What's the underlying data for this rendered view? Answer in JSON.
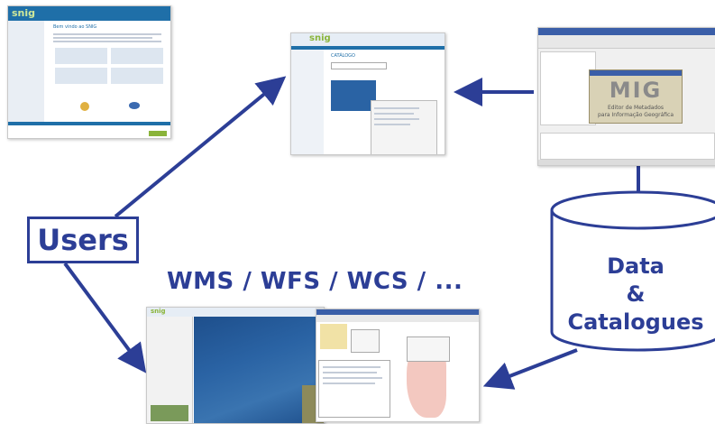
{
  "labels": {
    "users": "Users",
    "protocols": "WMS / WFS / WCS / ...",
    "data": "Data",
    "ampersand": "&",
    "catalogues": "Catalogues"
  },
  "screenshots": {
    "portal": {
      "logo": "snig",
      "heading": "Bem vindo ao SNIG"
    },
    "catalog": {
      "logo": "snig",
      "heading": "CATÁLOGO"
    },
    "editor": {
      "logo_text": "MIG",
      "subtitle_line1": "Editor de Metadados",
      "subtitle_line2": "para Informação Geográfica"
    },
    "viewer": {
      "logo": "snig"
    }
  },
  "colors": {
    "accent": "#2c3e96",
    "snig_green": "#8ab43a",
    "portal_blue": "#1f6fa8",
    "sea": "#2a63a4"
  }
}
